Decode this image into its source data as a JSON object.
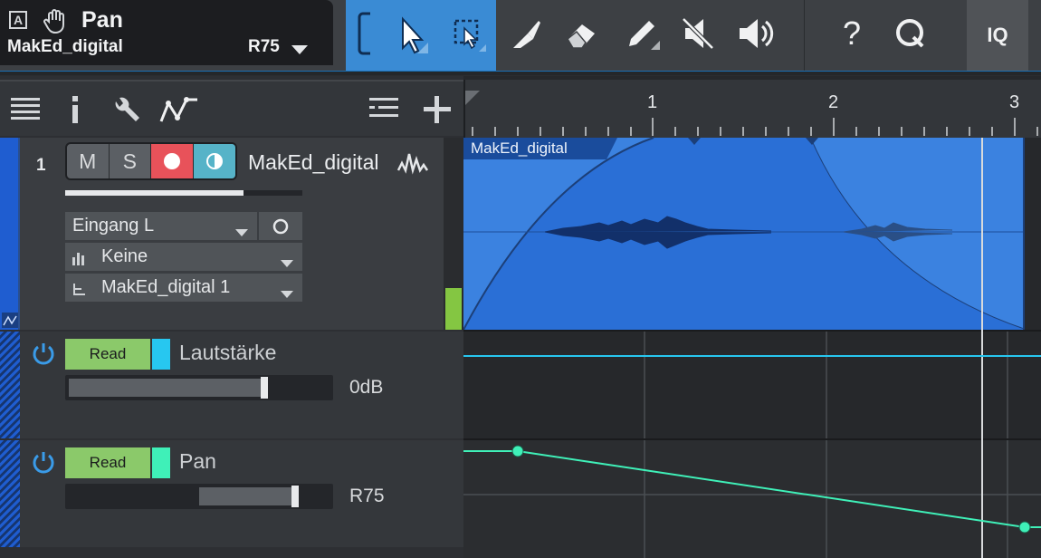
{
  "info": {
    "mode_letter": "A",
    "tool_icon": "hand-icon",
    "parameter": "Pan",
    "track_name": "MakEd_digital",
    "value": "R75"
  },
  "toolbar": {
    "tools": [
      "range-bracket-icon",
      "arrow-icon",
      "range-select-icon",
      "split-knife-icon",
      "eraser-icon",
      "pencil-icon",
      "mute-icon",
      "speaker-icon",
      "help-icon",
      "quantize-icon"
    ],
    "iq_label": "IQ"
  },
  "track_toolbar": {
    "icons": [
      "list-icon",
      "info-icon",
      "wrench-icon",
      "automation-icon",
      "list-settings-icon",
      "add-icon"
    ]
  },
  "track": {
    "number": "1",
    "mute": "M",
    "solo": "S",
    "name": "MakEd_digital",
    "input": "Eingang L",
    "sidechain": "Keine",
    "output": "MakEd_digital 1"
  },
  "lanes": [
    {
      "mode": "Read",
      "name": "Lautstärke",
      "value": "0dB",
      "color": "#27c7f0"
    },
    {
      "mode": "Read",
      "name": "Pan",
      "value": "R75",
      "color": "#3ff0b8"
    }
  ],
  "ruler": {
    "bars": [
      "1",
      "2",
      "3"
    ]
  },
  "clip": {
    "name": "MakEd_digital",
    "color": "#2a6fd6"
  },
  "colors": {
    "accent": "#3a8bd4",
    "track_color": "#1f5dd0",
    "record": "#e8525a",
    "monitor": "#56b3c8",
    "read_button": "#8bc96a",
    "meter": "#84c642"
  }
}
